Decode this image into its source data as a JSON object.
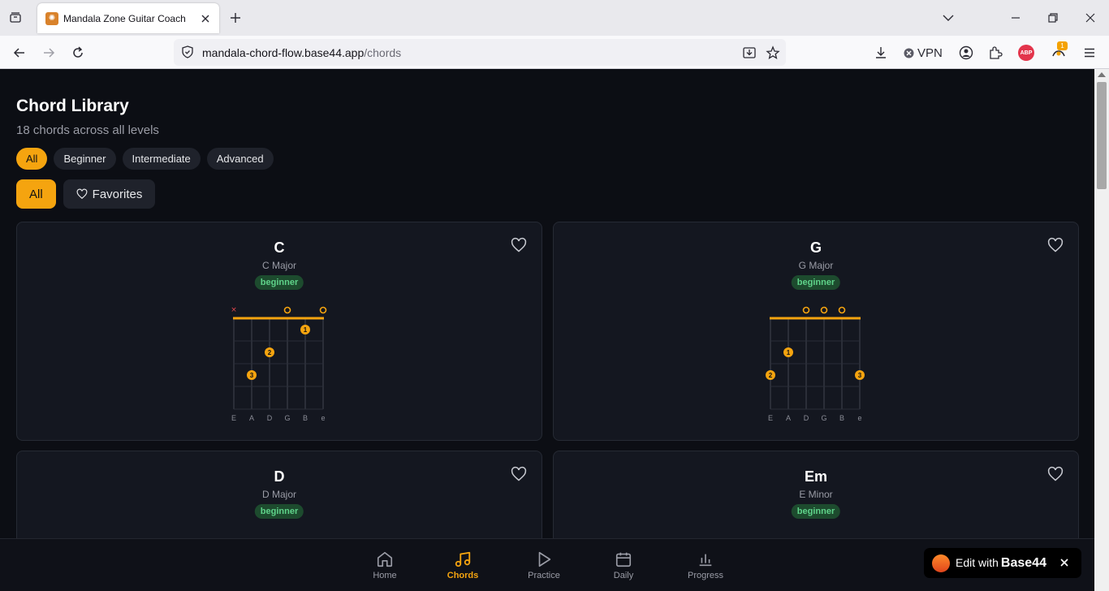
{
  "browser": {
    "tab_title": "Mandala Zone Guitar Coach",
    "url_domain": "mandala-chord-flow.base44.app",
    "url_path": "/chords",
    "vpn_label": "VPN",
    "abp_label": "ABP",
    "extension_badge": "1"
  },
  "page": {
    "title": "Chord Library",
    "subtitle": "18 chords across all levels",
    "level_filters": [
      "All",
      "Beginner",
      "Intermediate",
      "Advanced"
    ],
    "active_level": "All",
    "favorite_filters": [
      "All",
      "Favorites"
    ],
    "active_favorite_filter": "All"
  },
  "chords": [
    {
      "name": "C",
      "full_name": "C Major",
      "level": "beginner",
      "strings": [
        "E",
        "A",
        "D",
        "G",
        "B",
        "e"
      ],
      "string_states": [
        "x",
        "",
        "",
        "o",
        "",
        "o"
      ],
      "fingers": [
        {
          "string": 5,
          "fret": 1,
          "finger": "1"
        },
        {
          "string": 3,
          "fret": 2,
          "finger": "2"
        },
        {
          "string": 2,
          "fret": 3,
          "finger": "3"
        }
      ]
    },
    {
      "name": "G",
      "full_name": "G Major",
      "level": "beginner",
      "strings": [
        "E",
        "A",
        "D",
        "G",
        "B",
        "e"
      ],
      "string_states": [
        "",
        "",
        "o",
        "o",
        "o",
        ""
      ],
      "fingers": [
        {
          "string": 2,
          "fret": 2,
          "finger": "1"
        },
        {
          "string": 1,
          "fret": 3,
          "finger": "2"
        },
        {
          "string": 6,
          "fret": 3,
          "finger": "3"
        }
      ]
    },
    {
      "name": "D",
      "full_name": "D Major",
      "level": "beginner"
    },
    {
      "name": "Em",
      "full_name": "E Minor",
      "level": "beginner"
    }
  ],
  "bottom_nav": {
    "items": [
      {
        "label": "Home",
        "icon": "home-icon"
      },
      {
        "label": "Chords",
        "icon": "music-note-icon"
      },
      {
        "label": "Practice",
        "icon": "play-icon"
      },
      {
        "label": "Daily",
        "icon": "calendar-icon"
      },
      {
        "label": "Progress",
        "icon": "bar-chart-icon"
      }
    ],
    "active": "Chords"
  },
  "edit_badge": {
    "prefix": "Edit with",
    "brand": "Base44"
  },
  "colors": {
    "accent": "#f5a40f",
    "background": "#0c0e14",
    "card": "#141720",
    "badge_bg": "#1d4b2e",
    "badge_text": "#5fd38a",
    "muted_x": "#e5484d"
  }
}
